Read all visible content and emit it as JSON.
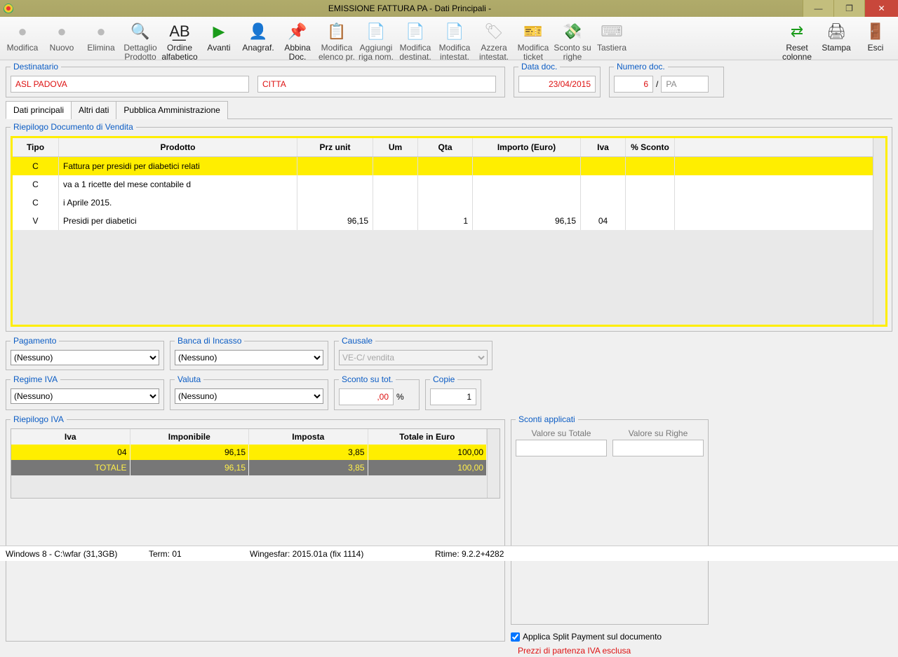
{
  "title": "EMISSIONE  FATTURA PA  - Dati Principali -",
  "toolbar": [
    {
      "id": "modifica",
      "label": "Modifica",
      "enabled": false,
      "glyph": "●"
    },
    {
      "id": "nuovo",
      "label": "Nuovo",
      "enabled": false,
      "glyph": "●"
    },
    {
      "id": "elimina",
      "label": "Elimina",
      "enabled": false,
      "glyph": "●"
    },
    {
      "id": "dettaglio",
      "label": "Dettaglio Prodotto",
      "enabled": false,
      "glyph": "🔍"
    },
    {
      "id": "ordine",
      "label": "Ordine alfabetico",
      "enabled": true,
      "glyph": "A͟B"
    },
    {
      "id": "avanti",
      "label": "Avanti",
      "enabled": true,
      "glyph": "▶",
      "color": "#1a9b1a"
    },
    {
      "id": "anagraf",
      "label": "Anagraf.",
      "enabled": true,
      "glyph": "👤"
    },
    {
      "id": "abbina",
      "label": "Abbina Doc.",
      "enabled": true,
      "glyph": "📌",
      "color": "#c33"
    },
    {
      "id": "mod-elenco",
      "label": "Modifica elenco pr.",
      "enabled": false,
      "glyph": "📋"
    },
    {
      "id": "agg-riga",
      "label": "Aggiungi riga nom.",
      "enabled": false,
      "glyph": "📄"
    },
    {
      "id": "mod-dest",
      "label": "Modifica destinat.",
      "enabled": false,
      "glyph": "📄"
    },
    {
      "id": "mod-int",
      "label": "Modifica intestat.",
      "enabled": false,
      "glyph": "📄"
    },
    {
      "id": "azzera",
      "label": "Azzera intestat.",
      "enabled": false,
      "glyph": "🏷"
    },
    {
      "id": "mod-ticket",
      "label": "Modifica ticket",
      "enabled": false,
      "glyph": "🎫"
    },
    {
      "id": "sconto-righe",
      "label": "Sconto su righe",
      "enabled": false,
      "glyph": "💸"
    },
    {
      "id": "tastiera",
      "label": "Tastiera",
      "enabled": false,
      "glyph": "⌨"
    }
  ],
  "toolbar_right": [
    {
      "id": "reset-col",
      "label": "Reset colonne",
      "glyph": "⇄",
      "color": "#1a9b1a"
    },
    {
      "id": "stampa",
      "label": "Stampa",
      "glyph": "🖨",
      "color": "#555"
    },
    {
      "id": "esci",
      "label": "Esci",
      "glyph": "🚪",
      "color": "#2c7"
    }
  ],
  "dest": {
    "legend": "Destinatario",
    "name": "ASL PADOVA",
    "city": "CITTA"
  },
  "date_doc": {
    "legend": "Data doc.",
    "value": "23/04/2015"
  },
  "num_doc": {
    "legend": "Numero doc.",
    "num": "6",
    "sep": "/",
    "suffix": "PA"
  },
  "tabs": [
    "Dati principali",
    "Altri dati",
    "Pubblica Amministrazione"
  ],
  "riepilogo_legend": "Riepilogo Documento di Vendita",
  "grid_headers": [
    "Tipo",
    "Prodotto",
    "Prz unit",
    "Um",
    "Qta",
    "Importo (Euro)",
    "Iva",
    "% Sconto"
  ],
  "grid_rows": [
    {
      "sel": true,
      "tipo": "C",
      "prod": "Fattura per presidi per diabetici relati",
      "prz": "",
      "um": "",
      "qta": "",
      "imp": "",
      "iva": "",
      "sc": ""
    },
    {
      "sel": false,
      "tipo": "C",
      "prod": "va a     1 ricette del mese contabile d",
      "prz": "",
      "um": "",
      "qta": "",
      "imp": "",
      "iva": "",
      "sc": ""
    },
    {
      "sel": false,
      "tipo": "C",
      "prod": "i Aprile    2015.",
      "prz": "",
      "um": "",
      "qta": "",
      "imp": "",
      "iva": "",
      "sc": ""
    },
    {
      "sel": false,
      "tipo": "V",
      "prod": "Presidi per diabetici",
      "prz": "96,15",
      "um": "",
      "qta": "1",
      "imp": "96,15",
      "iva": "04",
      "sc": ""
    }
  ],
  "pagamento": {
    "legend": "Pagamento",
    "value": "(Nessuno)"
  },
  "banca": {
    "legend": "Banca di Incasso",
    "value": "(Nessuno)"
  },
  "causale": {
    "legend": "Causale",
    "value": "VE-C/ vendita"
  },
  "regime": {
    "legend": "Regime IVA",
    "value": "(Nessuno)"
  },
  "valuta": {
    "legend": "Valuta",
    "value": "(Nessuno)"
  },
  "sconto_tot": {
    "legend": "Sconto su tot.",
    "value": ",00",
    "unit": "%"
  },
  "copie": {
    "legend": "Copie",
    "value": "1"
  },
  "iva_legend": "Riepilogo IVA",
  "iva_headers": [
    "Iva",
    "Imponibile",
    "Imposta",
    "Totale in Euro"
  ],
  "iva_rows": [
    {
      "y": true,
      "iva": "04",
      "imp": "96,15",
      "tax": "3,85",
      "tot": "100,00"
    },
    {
      "tot_row": true,
      "iva": "TOTALE",
      "imp": "96,15",
      "tax": "3,85",
      "tot": "100,00"
    }
  ],
  "sconti": {
    "legend": "Sconti applicati",
    "col1": "Valore su Totale",
    "col2": "Valore su Righe",
    "v1": "",
    "v2": "",
    "chk_label": "Applica Split Payment sul documento",
    "chk": true
  },
  "prezzi_note": "Prezzi di partenza IVA esclusa",
  "status": {
    "os": "Windows 8 - C:\\wfar (31,3GB)",
    "term": "Term: 01",
    "app": "Wingesfar: 2015.01a (fix 1114)",
    "rtime": "Rtime: 9.2.2+4282"
  }
}
